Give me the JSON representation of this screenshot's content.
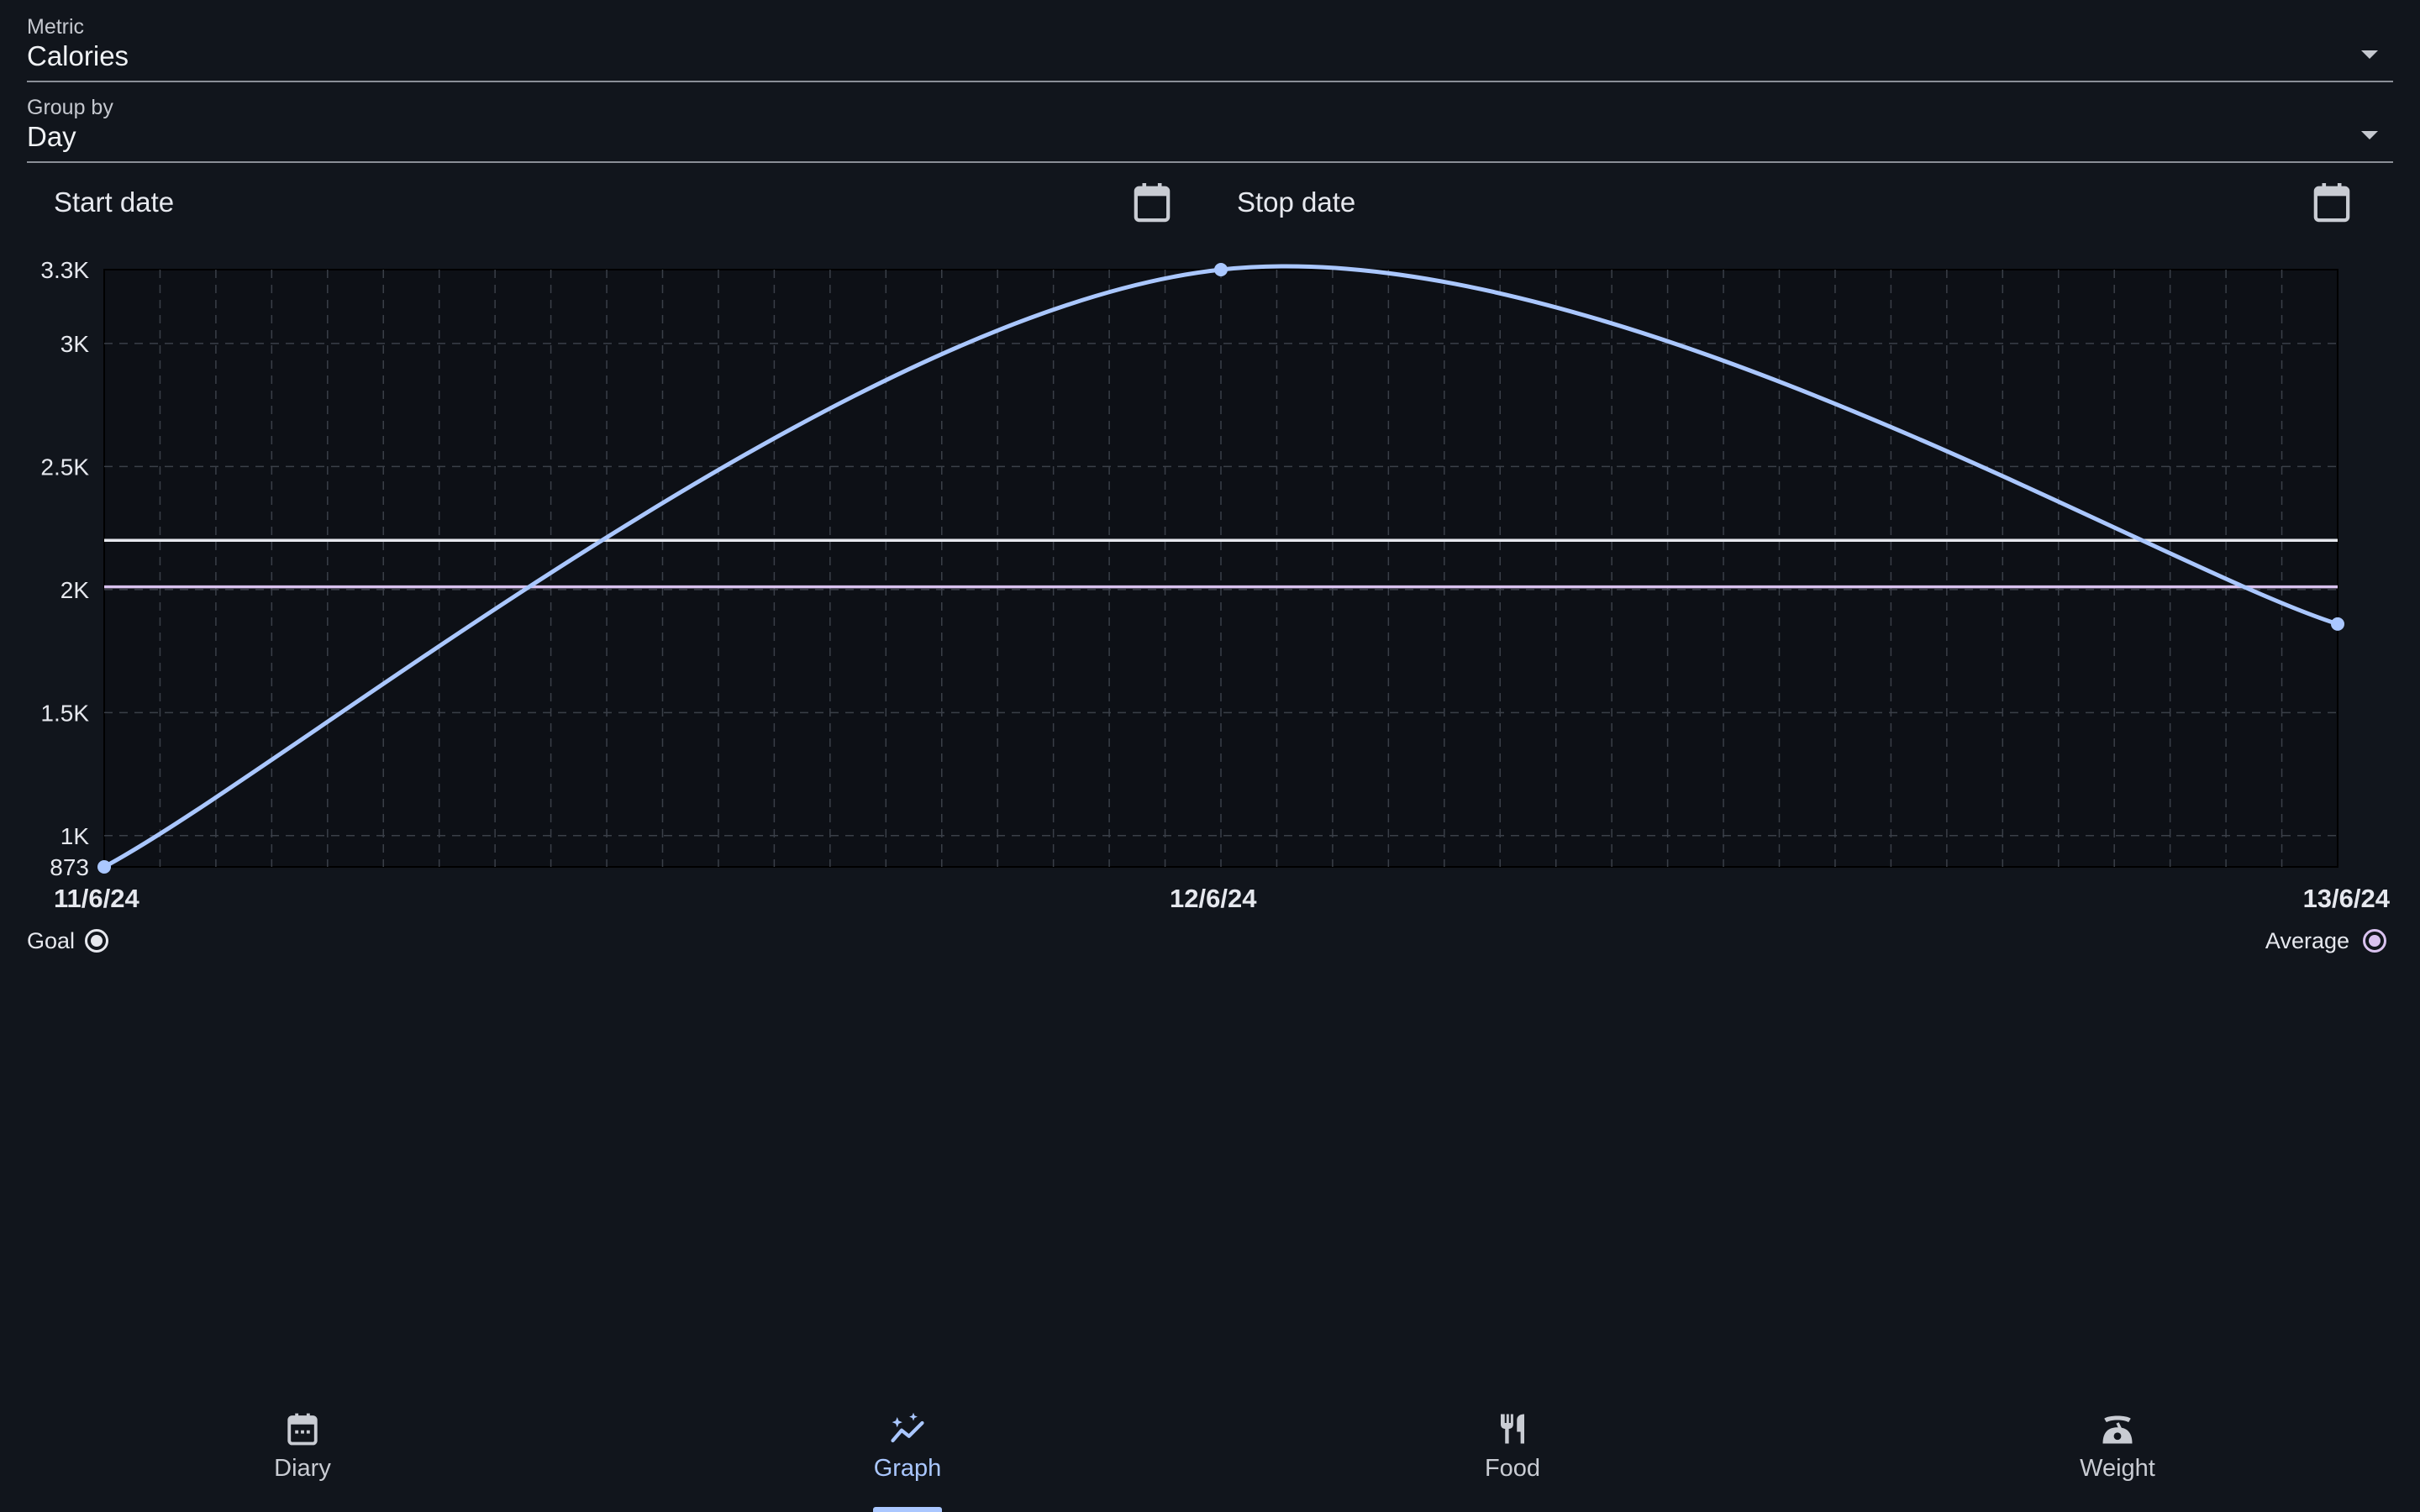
{
  "filters": {
    "metric": {
      "label": "Metric",
      "value": "Calories"
    },
    "group_by": {
      "label": "Group by",
      "value": "Day"
    },
    "start_date": {
      "label": "Start date"
    },
    "stop_date": {
      "label": "Stop date"
    }
  },
  "legend": {
    "goal": {
      "label": "Goal",
      "color": "#e6e8ee"
    },
    "average": {
      "label": "Average",
      "color": "#d9c2ef"
    }
  },
  "chart_data": {
    "type": "line",
    "x": [
      "11/6/24",
      "12/6/24",
      "13/6/24"
    ],
    "series": [
      {
        "values": [
          873,
          3300,
          1860
        ],
        "color": "#aac7ff"
      }
    ],
    "goal": 2200,
    "average": 2011,
    "ylim": [
      873,
      3300
    ],
    "y_ticks": [
      873,
      1000,
      1500,
      2000,
      2500,
      3000,
      3300
    ],
    "y_tick_labels": [
      "873",
      "1K",
      "1.5K",
      "2K",
      "2.5K",
      "3K",
      "3.3K"
    ],
    "grid": true,
    "legend_placement": "bottom"
  },
  "nav": {
    "items": [
      {
        "label": "Diary",
        "icon": "calendar-icon",
        "active": false
      },
      {
        "label": "Graph",
        "icon": "graph-icon",
        "active": true
      },
      {
        "label": "Food",
        "icon": "food-icon",
        "active": false
      },
      {
        "label": "Weight",
        "icon": "scale-icon",
        "active": false
      }
    ]
  },
  "colors": {
    "background": "#11151c",
    "accent": "#aac7ff",
    "text": "#e6e8ee"
  }
}
